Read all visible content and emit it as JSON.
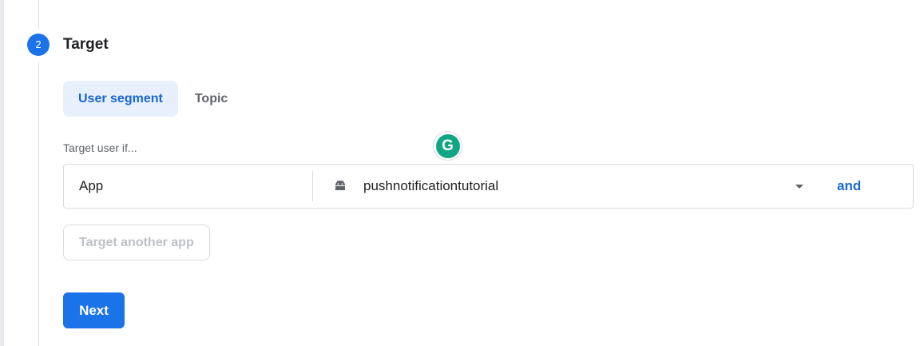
{
  "step": {
    "number": "2",
    "title": "Target"
  },
  "tabs": [
    {
      "label": "User segment",
      "active": true
    },
    {
      "label": "Topic",
      "active": false
    }
  ],
  "target_label": "Target user if...",
  "grammarly": {
    "letter": "G",
    "icon": "grammarly-icon"
  },
  "condition": {
    "field": "App",
    "platform_icon": "android-icon",
    "value": "pushnotificationtutorial",
    "and_label": "and"
  },
  "buttons": {
    "target_another": "Target another app",
    "next": "Next"
  },
  "colors": {
    "accent": "#1a73e8",
    "accent_text": "#1967d2",
    "tab_active_bg": "#e8f0fe",
    "border": "#dadce0",
    "muted": "#5f6368",
    "disabled_text": "#bdc1c6",
    "grammarly": "#11a683"
  }
}
